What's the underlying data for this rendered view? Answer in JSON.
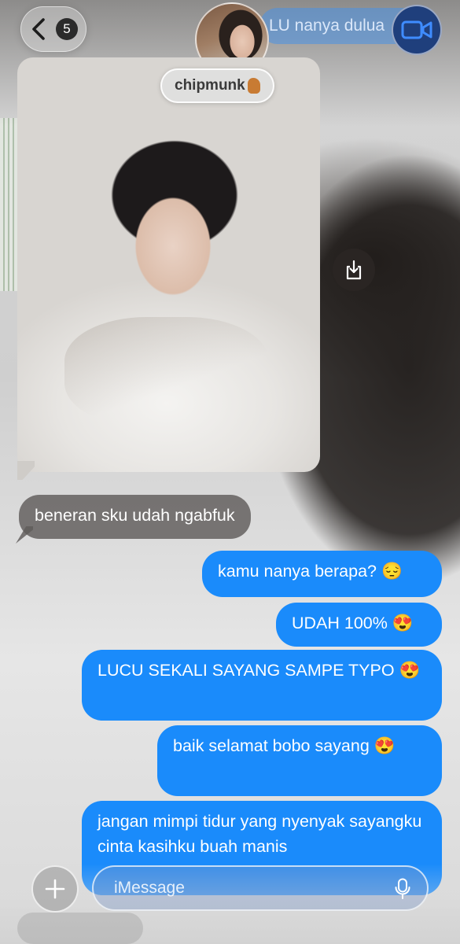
{
  "header": {
    "unread_count": "5",
    "contact_name": "chipmunk",
    "previous_message_preview": "LU nanya dulua"
  },
  "icons": {
    "back": "chevron-left-icon",
    "video": "video-camera-icon",
    "save": "download-icon",
    "plus": "plus-icon",
    "mic": "microphone-icon"
  },
  "messages": [
    {
      "direction": "incoming",
      "type": "photo"
    },
    {
      "direction": "incoming",
      "text": "beneran sku udah ngabfuk"
    },
    {
      "direction": "outgoing",
      "text": "kamu nanya berapa? 😔"
    },
    {
      "direction": "outgoing",
      "text": "UDAH 100% 😍"
    },
    {
      "direction": "outgoing",
      "text": "LUCU SEKALI  SAYANG SAMPE TYPO 😍"
    },
    {
      "direction": "outgoing",
      "text": "baik selamat bobo sayang 😍"
    },
    {
      "direction": "outgoing",
      "text": "jangan mimpi tidur yang nyenyak sayangku cinta kasihku buah manis"
    }
  ],
  "composer": {
    "placeholder": "iMessage"
  },
  "colors": {
    "outgoing_bubble": "#1a8bfb",
    "incoming_bubble": "#5f5c5a",
    "video_button": "#1f3f7c"
  }
}
